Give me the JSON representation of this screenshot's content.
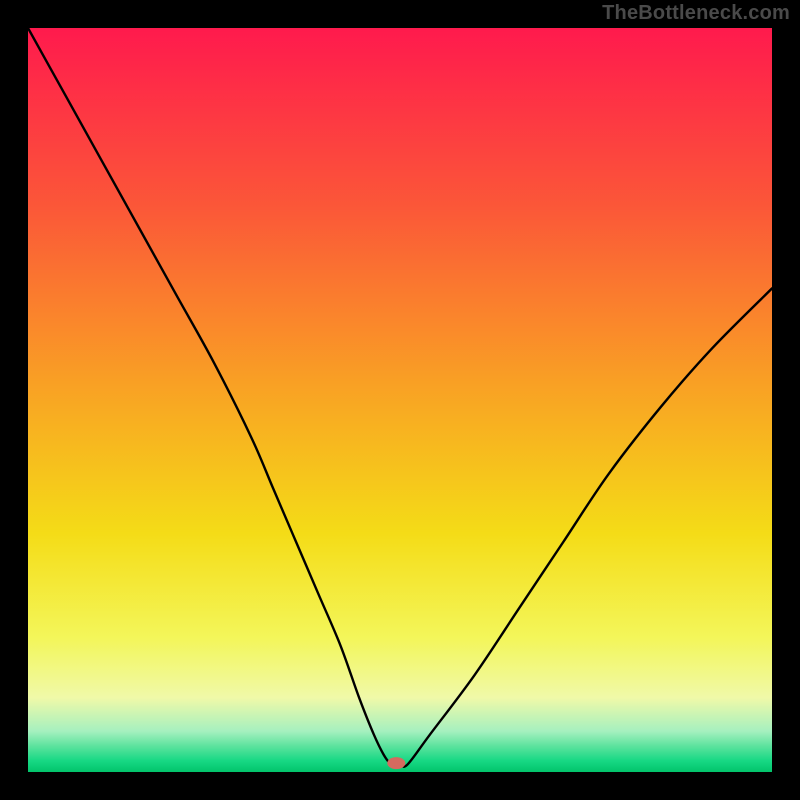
{
  "watermark": "TheBottleneck.com",
  "chart_data": {
    "type": "line",
    "title": "",
    "xlabel": "",
    "ylabel": "",
    "xlim": [
      0,
      100
    ],
    "ylim": [
      0,
      100
    ],
    "grid": false,
    "background_gradient": [
      {
        "offset": 0.0,
        "color": "#ff1a4d"
      },
      {
        "offset": 0.24,
        "color": "#fb5738"
      },
      {
        "offset": 0.48,
        "color": "#f9a124"
      },
      {
        "offset": 0.68,
        "color": "#f4dc17"
      },
      {
        "offset": 0.82,
        "color": "#f3f65a"
      },
      {
        "offset": 0.9,
        "color": "#f0f9a8"
      },
      {
        "offset": 0.945,
        "color": "#a6f0bf"
      },
      {
        "offset": 0.965,
        "color": "#5de39e"
      },
      {
        "offset": 0.985,
        "color": "#17d884"
      },
      {
        "offset": 1.0,
        "color": "#02c46b"
      }
    ],
    "series": [
      {
        "name": "bottleneck-curve",
        "x": [
          0,
          5,
          10,
          15,
          20,
          25,
          30,
          33,
          36,
          39,
          42,
          44.5,
          46.5,
          48,
          49,
          50,
          51,
          54,
          60,
          66,
          72,
          78,
          85,
          92,
          100
        ],
        "y": [
          100,
          91,
          82,
          73,
          64,
          55,
          45,
          38,
          31,
          24,
          17,
          10,
          5,
          2,
          1,
          1,
          1,
          5,
          13,
          22,
          31,
          40,
          49,
          57,
          65
        ]
      }
    ],
    "marker": {
      "name": "bottleneck-point",
      "x": 49.5,
      "y": 1.2,
      "color": "#d46a5f",
      "rx": 9,
      "ry": 6
    }
  }
}
